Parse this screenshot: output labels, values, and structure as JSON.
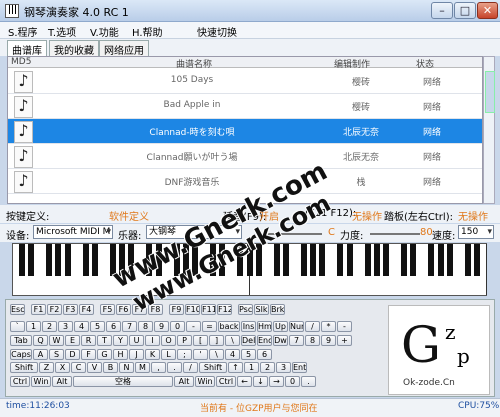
{
  "window": {
    "title": "钢琴演奏家 4.0 RC 1",
    "min_glyph": "–",
    "max_glyph": "□",
    "close_glyph": "✕"
  },
  "menu": [
    {
      "label": "S.程序"
    },
    {
      "label": "T.选项"
    },
    {
      "label": "V.功能"
    },
    {
      "label": "H.帮助"
    },
    {
      "label": "快速切换"
    }
  ],
  "tabs": [
    {
      "label": "曲谱库",
      "active": true
    },
    {
      "label": "我的收藏"
    },
    {
      "label": "网络应用"
    }
  ],
  "list": {
    "headers": {
      "md5": "MD5",
      "name": "曲谱名称",
      "maker": "编辑制作",
      "state": "状态"
    },
    "rows": [
      {
        "name": "105 Days",
        "maker": "樱砖",
        "state": "网络"
      },
      {
        "name": "Bad Apple in",
        "maker": "樱砖",
        "state": "网络"
      },
      {
        "name": "Clannad-時を刻む唄",
        "maker": "北辰无奈",
        "state": "网络",
        "selected": true
      },
      {
        "name": "Clannad願いが叶う場",
        "maker": "北辰无奈",
        "state": "网络"
      },
      {
        "name": "DNF游戏音乐",
        "maker": "栈",
        "state": "网络"
      }
    ]
  },
  "controls": {
    "keydef_label": "按键定义:",
    "keydef_value": "软件定义",
    "pedal_label": "延音(F9):",
    "pedal_value": "开启",
    "shift_keys": "(F11 F12):",
    "no_op1": "无操作",
    "tremolo_label": "踏板(左右Ctrl):",
    "no_op2": "无操作",
    "device_label": "设备:",
    "device_value": "Microsoft MIDI M",
    "instrument_label": "乐器:",
    "instrument_value": "大钢琴",
    "c_label": "C",
    "force_label": "力度:",
    "force_value": "80",
    "speed_label": "速度:",
    "speed_value": "150"
  },
  "keyboard": {
    "row1": [
      "Esc",
      "F1",
      "F2",
      "F3",
      "F4",
      "F5",
      "F6",
      "F7",
      "F8",
      "F9",
      "F10",
      "F11",
      "F12",
      "Psc",
      "Slk",
      "Brk"
    ],
    "row2": [
      "`",
      "1",
      "2",
      "3",
      "4",
      "5",
      "6",
      "7",
      "8",
      "9",
      "0",
      "-",
      "=",
      "back",
      "Ins",
      "Hm",
      "Up",
      "Num",
      "/",
      "*",
      "-"
    ],
    "row3": [
      "Tab",
      "Q",
      "W",
      "E",
      "R",
      "T",
      "Y",
      "U",
      "I",
      "O",
      "P",
      "[",
      "]",
      "\\",
      "Del",
      "End",
      "Dw",
      "7",
      "8",
      "9",
      "+"
    ],
    "row4": [
      "Caps",
      "A",
      "S",
      "D",
      "F",
      "G",
      "H",
      "J",
      "K",
      "L",
      ";",
      "'",
      "\\",
      "4",
      "5",
      "6"
    ],
    "row5": [
      "Shift",
      "Z",
      "X",
      "C",
      "V",
      "B",
      "N",
      "M",
      ",",
      ".",
      "/",
      "Shift",
      "↑",
      "1",
      "2",
      "3",
      "Ent"
    ],
    "row6": [
      "Ctrl",
      "Win",
      "Alt",
      "空格",
      "Alt",
      "Win",
      "Ctrl",
      "←",
      "↓",
      "→",
      "0",
      "."
    ]
  },
  "logo": {
    "g": "G",
    "z": "z",
    "p": "p",
    "text": "Ok-zode.Cn"
  },
  "status": {
    "time": "time:11:26:03",
    "message": "当前有 - 位GZP用户与您同在",
    "cpu": "CPU:75%"
  },
  "watermark": [
    "www.Gnerk.com",
    "www.Gnerk.com"
  ]
}
